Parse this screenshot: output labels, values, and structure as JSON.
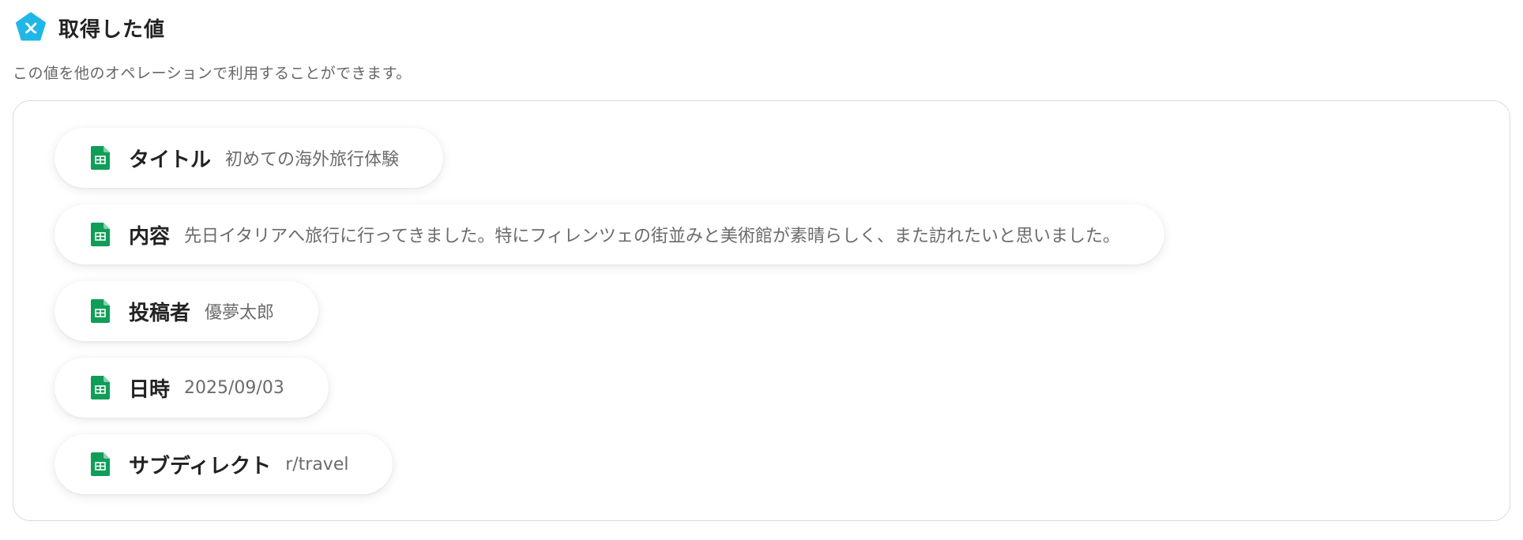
{
  "header": {
    "title": "取得した値",
    "description": "この値を他のオペレーションで利用することができます。"
  },
  "fields": [
    {
      "label": "タイトル",
      "value": "初めての海外旅行体験"
    },
    {
      "label": "内容",
      "value": "先日イタリアへ旅行に行ってきました。特にフィレンツェの街並みと美術館が素晴らしく、また訪れたいと思いました。"
    },
    {
      "label": "投稿者",
      "value": "優夢太郎"
    },
    {
      "label": "日時",
      "value": "2025/09/03"
    },
    {
      "label": "サブディレクト",
      "value": "r/travel"
    }
  ],
  "icons": {
    "logo": "yoom-pentagon-x-icon",
    "field": "google-sheets-icon"
  },
  "colors": {
    "logo": "#1fb7e6",
    "sheets": "#0f9d58",
    "label": "#222222",
    "value": "#6b6b6b",
    "border": "#d9d9d9"
  }
}
